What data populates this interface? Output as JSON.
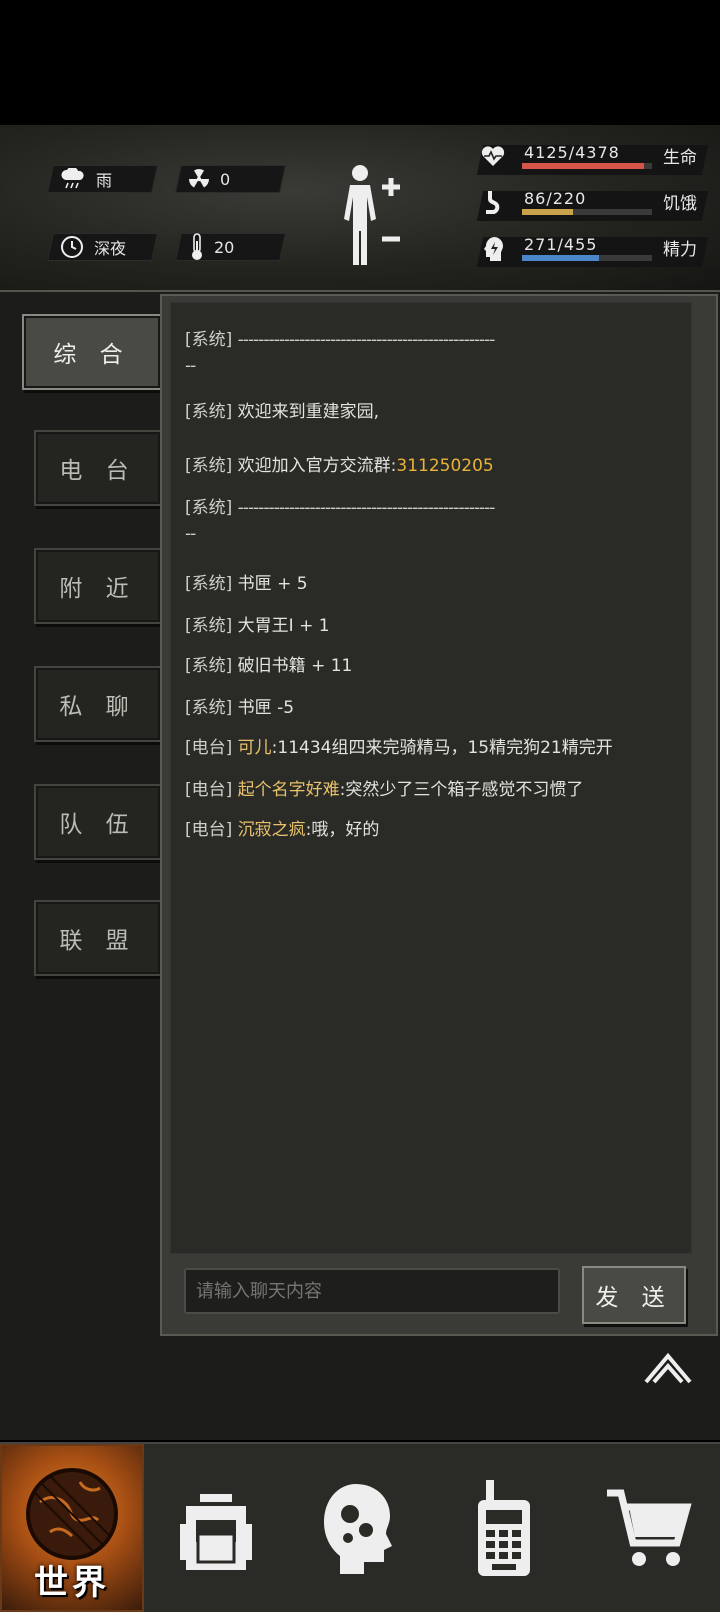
{
  "status": {
    "weather": "雨",
    "radiation": "0",
    "time_of_day": "深夜",
    "temperature": "20",
    "stats": [
      {
        "value": "4125/4378",
        "label": "生命",
        "fill": 0.942,
        "color": "#d65448",
        "icon": "heart-pulse-icon"
      },
      {
        "value": "86/220",
        "label": "饥饿",
        "fill": 0.391,
        "color": "#c9a24b",
        "icon": "stomach-icon"
      },
      {
        "value": "271/455",
        "label": "精力",
        "fill": 0.596,
        "color": "#4a86c8",
        "icon": "energy-head-icon"
      }
    ]
  },
  "tabs": [
    "综 合",
    "电 台",
    "附 近",
    "私 聊",
    "队 伍",
    "联 盟"
  ],
  "active_tab": 0,
  "chat": {
    "messages": [
      {
        "tag": "[系统]",
        "text": "--------------------------------------------------",
        "cont": "--",
        "kind": "divider"
      },
      {
        "tag": "[系统]",
        "text": "欢迎来到重建家园,"
      },
      {
        "tag": "[系统]",
        "text": " 欢迎加入官方交流群:",
        "highlight": "311250205"
      },
      {
        "tag": "[系统]",
        "text": "--------------------------------------------------",
        "cont": "--",
        "kind": "divider"
      },
      {
        "tag": "[系统]",
        "text": "书匣 + 5"
      },
      {
        "tag": "[系统]",
        "text": "大胃王Ⅰ + 1"
      },
      {
        "tag": "[系统]",
        "text": "破旧书籍 + 11"
      },
      {
        "tag": "[系统]",
        "text": "书匣 -5"
      },
      {
        "tag": "[电台]",
        "sender": "可儿",
        "text": ":11434组四来完骑精马，15精完狗21精完开"
      },
      {
        "tag": "[电台]",
        "sender": "起个名字好难",
        "text": ":突然少了三个箱子感觉不习惯了"
      },
      {
        "tag": "[电台]",
        "sender": "沉寂之疯",
        "text": ":哦，好的"
      }
    ],
    "input_placeholder": "请输入聊天内容",
    "send_label": "发 送"
  },
  "nav": {
    "active_label": "世界",
    "items": [
      "world-globe-icon",
      "backpack-icon",
      "skills-head-icon",
      "radio-walkie-icon",
      "shopping-cart-icon"
    ]
  }
}
